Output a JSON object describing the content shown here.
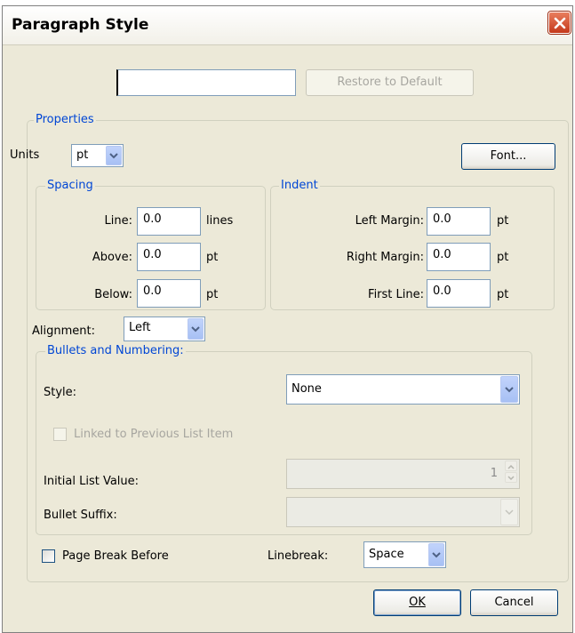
{
  "window": {
    "title": "Paragraph Style"
  },
  "name_field": {
    "value": ""
  },
  "buttons": {
    "restore_default": "Restore to Default",
    "font": "Font...",
    "ok": "OK",
    "cancel": "Cancel"
  },
  "properties": {
    "legend": "Properties",
    "units_label": "Units",
    "units_value": "pt",
    "spacing": {
      "legend": "Spacing",
      "line_label": "Line:",
      "line_value": "0.0",
      "line_unit": "lines",
      "above_label": "Above:",
      "above_value": "0.0",
      "above_unit": "pt",
      "below_label": "Below:",
      "below_value": "0.0",
      "below_unit": "pt"
    },
    "indent": {
      "legend": "Indent",
      "left_label": "Left Margin:",
      "left_value": "0.0",
      "left_unit": "pt",
      "right_label": "Right Margin:",
      "right_value": "0.0",
      "right_unit": "pt",
      "first_label": "First Line:",
      "first_value": "0.0",
      "first_unit": "pt"
    },
    "alignment_label": "Alignment:",
    "alignment_value": "Left",
    "bullets": {
      "legend": "Bullets and Numbering:",
      "style_label": "Style:",
      "style_value": "None",
      "linked_label": "Linked to Previous List Item",
      "initial_label": "Initial List Value:",
      "initial_value": "1",
      "suffix_label": "Bullet Suffix:",
      "suffix_value": ""
    },
    "page_break_label": "Page Break Before",
    "linebreak_label": "Linebreak:",
    "linebreak_value": "Space"
  },
  "colors": {
    "dialog_bg": "#ece9d8",
    "legend_text": "#0046d5",
    "close_button": "#c4381b"
  }
}
